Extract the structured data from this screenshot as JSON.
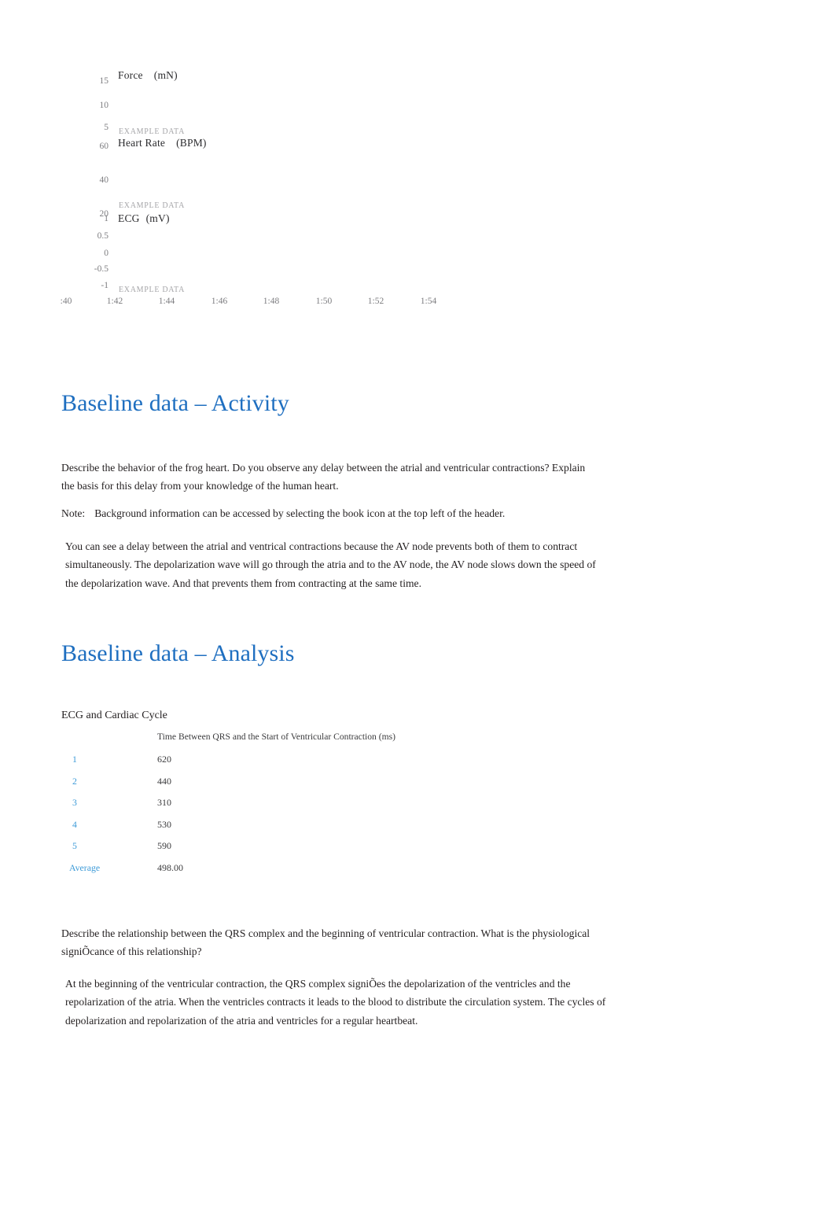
{
  "chart_data": {
    "type": "line",
    "title": "",
    "panels": [
      {
        "name": "force",
        "series_label": "Force",
        "unit": "(mN)",
        "watermark": "EXAMPLE DATA",
        "ylabel": "Force (mN)",
        "yticks": [
          "15",
          "10",
          "5"
        ],
        "ylim": [
          0,
          17
        ]
      },
      {
        "name": "heart-rate",
        "series_label": "Heart Rate",
        "unit": "(BPM)",
        "watermark": "EXAMPLE DATA",
        "ylabel": "Heart Rate (BPM)",
        "yticks": [
          "60",
          "40",
          "20"
        ],
        "ylim": [
          10,
          70
        ]
      },
      {
        "name": "ecg",
        "series_label": "ECG",
        "unit": "(mV)",
        "watermark": "EXAMPLE DATA",
        "ylabel": "ECG (mV)",
        "yticks": [
          "1",
          "0.5",
          "0",
          "-0.5",
          "-1"
        ],
        "ylim": [
          -1,
          1
        ]
      }
    ],
    "xlabel": "",
    "xticks": [
      ":40",
      "1:42",
      "1:44",
      "1:46",
      "1:48",
      "1:50",
      "1:52",
      "1:54"
    ],
    "grid": false,
    "legend": "none"
  },
  "sections": {
    "activity": {
      "heading": "Baseline data – Activity",
      "question": "Describe the behavior of the frog heart. Do you observe any delay between the atrial and ventricular contractions? Explain the basis for this delay from your knowledge of the human heart.",
      "note_label": "Note:",
      "note_text": "Background information can be accessed by selecting the book icon at the top left of the header.",
      "answer": "You can see a delay between the atrial and ventrical contractions because the AV node prevents both of them to contract simultaneously. The depolarization wave will go through the atria and to the AV node, the AV node slows down the speed of the depolarization wave. And that prevents them from contracting at the same time."
    },
    "analysis": {
      "heading": "Baseline data – Analysis",
      "subheading": "ECG and Cardiac Cycle",
      "table": {
        "row_header": "",
        "column_header": "Time Between QRS and the Start of Ventricular Contraction (ms)",
        "rows": [
          {
            "label": "1",
            "value": "620"
          },
          {
            "label": "2",
            "value": "440"
          },
          {
            "label": "3",
            "value": "310"
          },
          {
            "label": "4",
            "value": "530"
          },
          {
            "label": "5",
            "value": "590"
          }
        ],
        "average_label": "Average",
        "average_value": "498.00"
      },
      "question": "Describe the relationship between the QRS complex and the beginning of ventricular contraction. What is the physiological signiÕcance of this relationship?",
      "answer": "At the beginning of the ventricular contraction, the QRS complex signiÕes the depolarization of the ventricles and the repolarization of the atria. When the ventricles contracts it leads to the blood to distribute the circulation system. The cycles of depolarization and repolarization of the atria and ventricles for a regular heartbeat."
    }
  },
  "colors": {
    "heading_blue": "#1f6fc0",
    "table_label_blue": "#3e9bd8",
    "axis_gray": "#7d7d80",
    "watermark_gray": "#a5a5a8",
    "body_text": "#231f20"
  }
}
